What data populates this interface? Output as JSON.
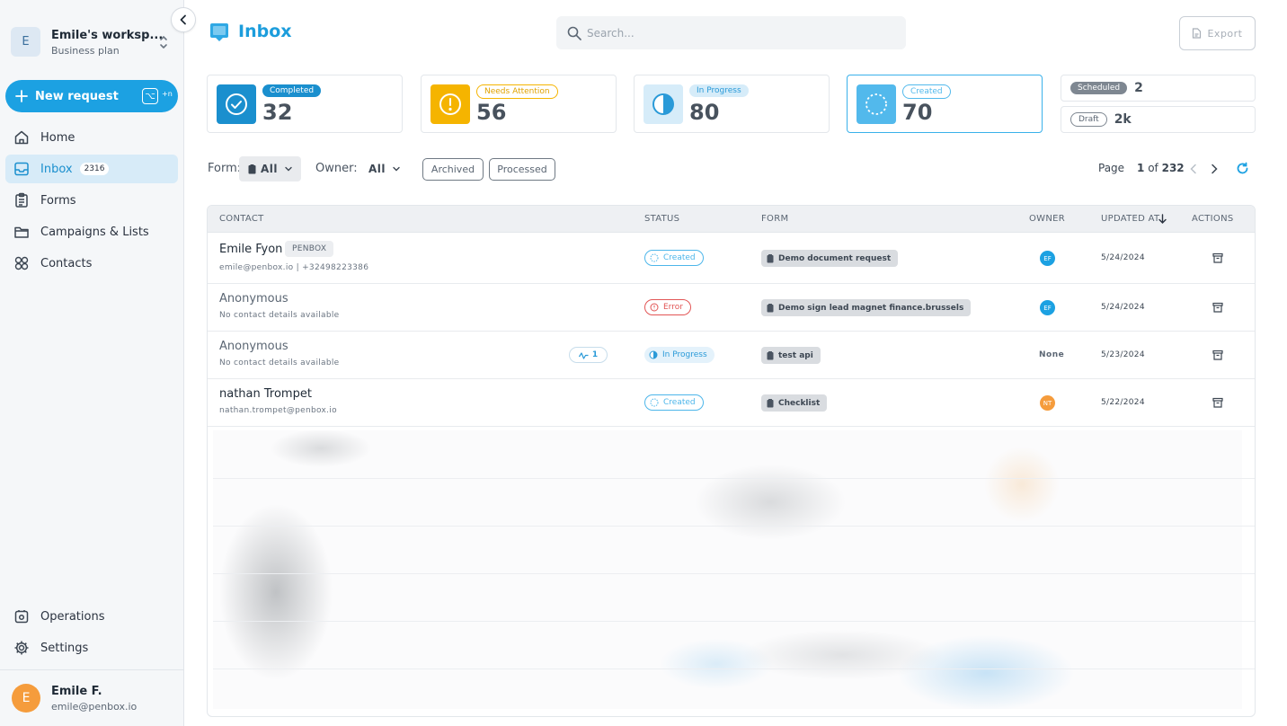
{
  "workspace": {
    "initial": "E",
    "name": "Emile's worksp...",
    "plan": "Business plan"
  },
  "new_request": {
    "label": "New request",
    "shortcut_symbol": "⌥",
    "shortcut_key": "+n"
  },
  "nav": {
    "home": "Home",
    "inbox": "Inbox",
    "inbox_count": "2316",
    "forms": "Forms",
    "campaigns": "Campaigns & Lists",
    "contacts": "Contacts",
    "operations": "Operations",
    "settings": "Settings"
  },
  "user": {
    "initial": "E",
    "name": "Emile F.",
    "email": "emile@penbox.io"
  },
  "header": {
    "title": "Inbox",
    "search_placeholder": "Search...",
    "export_label": "Export"
  },
  "stats": {
    "completed": {
      "label": "Completed",
      "value": "32"
    },
    "needs_attention": {
      "label": "Needs Attention",
      "value": "56"
    },
    "in_progress": {
      "label": "In Progress",
      "value": "80"
    },
    "created": {
      "label": "Created",
      "value": "70"
    },
    "scheduled": {
      "label": "Scheduled",
      "value": "2"
    },
    "draft": {
      "label": "Draft",
      "value": "2k"
    }
  },
  "filters": {
    "form_label": "Form:",
    "form_value": "All",
    "owner_label": "Owner:",
    "owner_value": "All",
    "archived": "Archived",
    "processed": "Processed"
  },
  "pager": {
    "label": "Page",
    "current": "1",
    "of_text": "of",
    "total": "232"
  },
  "table": {
    "columns": {
      "contact": "CONTACT",
      "status": "STATUS",
      "form": "FORM",
      "owner": "OWNER",
      "updated": "UPDATED AT",
      "actions": "ACTIONS"
    },
    "rows": [
      {
        "name": "Emile Fyon",
        "tag": "PENBOX",
        "sub": "emile@penbox.io | +32498223386",
        "status": "Created",
        "form": "Demo document request",
        "owner": "EF",
        "date": "5/24/2024"
      },
      {
        "name": "Anonymous",
        "sub": "No contact details available",
        "status": "Error",
        "form": "Demo sign lead magnet finance.brussels",
        "owner": "EF",
        "date": "5/24/2024"
      },
      {
        "name": "Anonymous",
        "sub": "No contact details available",
        "activity": "1",
        "status": "In Progress",
        "form": "test api",
        "owner": "None",
        "date": "5/23/2024"
      },
      {
        "name": "nathan Trompet",
        "sub": "nathan.trompet@penbox.io",
        "status": "Created",
        "form": "Checklist",
        "owner": "NT",
        "date": "5/22/2024"
      }
    ]
  },
  "colors": {
    "accent": "#1ca1e2",
    "completed": "#1a8fce",
    "needs_attention": "#f5b400",
    "owner_ef": "#1ca1e2",
    "owner_nt": "#f59c3c",
    "error": "#e25555"
  }
}
